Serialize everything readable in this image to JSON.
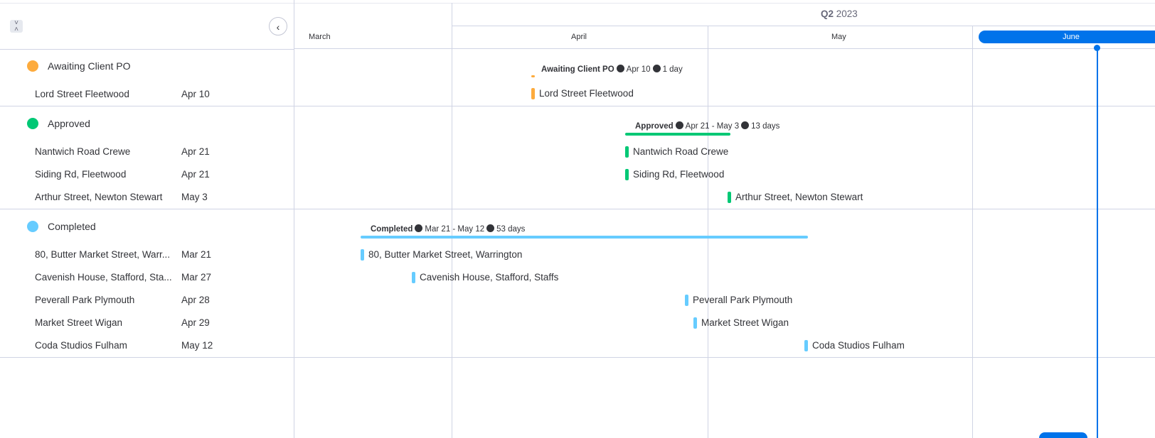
{
  "header": {
    "quarter_prefix": "Q2",
    "quarter_year": "2023"
  },
  "months": [
    "March",
    "April",
    "May",
    "June"
  ],
  "colors": {
    "awaiting": "#fdab3d",
    "approved": "#00c875",
    "completed": "#66ccff",
    "today": "#0073ea"
  },
  "icons": {
    "collapse": "collapse-icon",
    "back": "chevron-left-icon"
  },
  "groups": [
    {
      "title": "Awaiting Client PO",
      "summary": {
        "title": "Awaiting Client PO",
        "range": "Apr 10",
        "duration": "1 day"
      },
      "items": [
        {
          "name": "Lord Street Fleetwood",
          "date": "Apr 10"
        }
      ]
    },
    {
      "title": "Approved",
      "summary": {
        "title": "Approved",
        "range": "Apr 21 - May 3",
        "duration": "13 days"
      },
      "items": [
        {
          "name": "Nantwich Road Crewe",
          "date": "Apr 21"
        },
        {
          "name": "Siding Rd, Fleetwood",
          "date": "Apr 21"
        },
        {
          "name": "Arthur Street, Newton Stewart",
          "date": "May 3"
        }
      ]
    },
    {
      "title": "Completed",
      "summary": {
        "title": "Completed",
        "range": "Mar 21 - May 12",
        "duration": "53 days"
      },
      "items": [
        {
          "name": "80, Butter Market Street, Warr...",
          "label": "80, Butter Market Street, Warrington",
          "date": "Mar 21"
        },
        {
          "name": "Cavenish House, Stafford, Sta...",
          "label": "Cavenish House, Stafford, Staffs",
          "date": "Mar 27"
        },
        {
          "name": "Peverall Park Plymouth",
          "label": "Peverall Park Plymouth",
          "date": "Apr 28"
        },
        {
          "name": "Market Street Wigan",
          "label": "Market Street Wigan",
          "date": "Apr 29"
        },
        {
          "name": "Coda Studios Fulham",
          "label": "Coda Studios Fulham",
          "date": "May 12"
        }
      ]
    }
  ]
}
